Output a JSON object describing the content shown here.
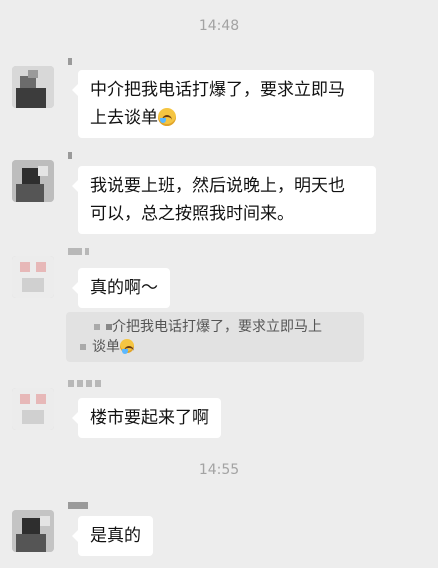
{
  "timestamps": [
    "14:48",
    "14:55"
  ],
  "messages": [
    {
      "lines": [
        "中介把我电话打爆了，要求立即马",
        "上去谈单"
      ],
      "emoji": "laugh-cry-emoji"
    },
    {
      "lines": [
        "我说要上班，然后说晚上，明天也",
        "可以，总之按照我时间来。"
      ]
    },
    {
      "lines": [
        "真的啊～"
      ]
    },
    {
      "lines": [
        "楼市要起来了啊"
      ]
    },
    {
      "lines": [
        "是真的"
      ]
    }
  ],
  "quote": {
    "lines": [
      "介把我电话打爆了，要求立即马上",
      "谈单"
    ],
    "emoji": "laugh-cry-emoji"
  }
}
